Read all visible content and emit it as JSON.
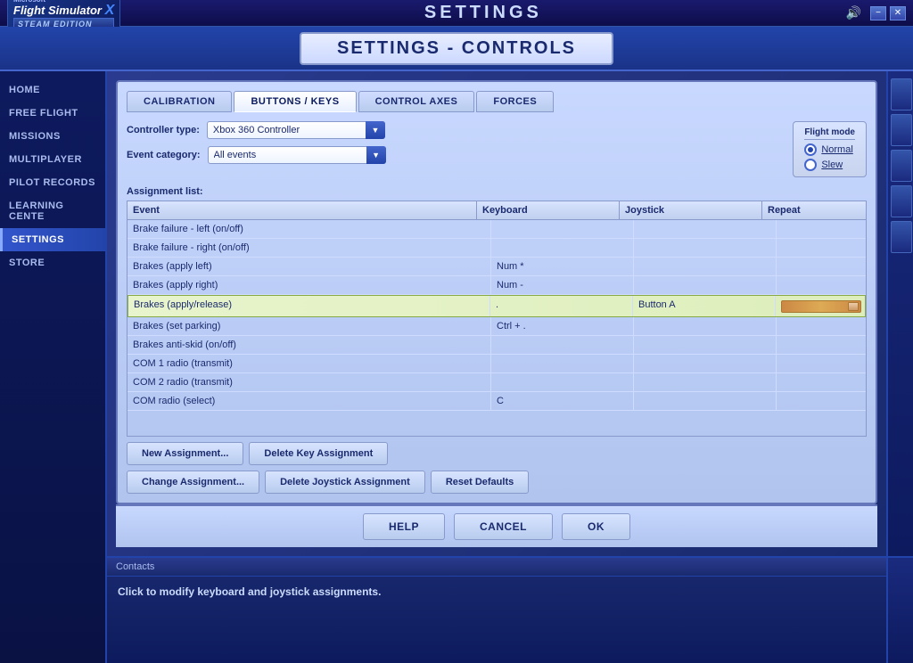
{
  "app": {
    "title": "Microsoft Flight Simulator X",
    "subtitle": "STEAM EDITION",
    "main_title": "SETTINGS",
    "sub_title": "SETTINGS - CONTROLS"
  },
  "titlebar": {
    "sound_icon": "🔊",
    "minimize": "−",
    "close": "✕"
  },
  "sidebar": {
    "items": [
      {
        "id": "home",
        "label": "HOME"
      },
      {
        "id": "free-flight",
        "label": "FREE FLIGHT"
      },
      {
        "id": "missions",
        "label": "MISSIONS"
      },
      {
        "id": "multiplayer",
        "label": "MULTIPLAYER"
      },
      {
        "id": "pilot-records",
        "label": "PILOT RECORDS"
      },
      {
        "id": "learning",
        "label": "LEARNING CENTE"
      },
      {
        "id": "settings",
        "label": "SETTINGS",
        "active": true
      },
      {
        "id": "store",
        "label": "STORE"
      }
    ]
  },
  "tabs": {
    "items": [
      {
        "id": "calibration",
        "label": "CALIBRATION"
      },
      {
        "id": "buttons-keys",
        "label": "BUTTONS / KEYS",
        "active": true
      },
      {
        "id": "control-axes",
        "label": "CONTROL AXES"
      },
      {
        "id": "forces",
        "label": "FORCES"
      }
    ]
  },
  "form": {
    "controller_type_label": "Controller type:",
    "controller_type_value": "Xbox 360 Controller",
    "event_category_label": "Event category:",
    "event_category_value": "All events",
    "assignment_list_label": "Assignment list:"
  },
  "flight_mode": {
    "title": "Flight mode",
    "normal_label": "Normal",
    "slew_label": "Slew",
    "selected": "normal"
  },
  "table": {
    "headers": [
      "Event",
      "Keyboard",
      "Joystick",
      "Repeat"
    ],
    "rows": [
      {
        "event": "Brake failure - left (on/off)",
        "keyboard": "",
        "joystick": "",
        "repeat": "",
        "selected": false
      },
      {
        "event": "Brake failure - right (on/off)",
        "keyboard": "",
        "joystick": "",
        "repeat": "",
        "selected": false
      },
      {
        "event": "Brakes (apply left)",
        "keyboard": "Num *",
        "joystick": "",
        "repeat": "",
        "selected": false
      },
      {
        "event": "Brakes (apply right)",
        "keyboard": "Num -",
        "joystick": "",
        "repeat": "",
        "selected": false
      },
      {
        "event": "Brakes (apply/release)",
        "keyboard": ".",
        "joystick": "Button A",
        "repeat": "slider",
        "selected": true
      },
      {
        "event": "Brakes (set parking)",
        "keyboard": "Ctrl + .",
        "joystick": "",
        "repeat": "",
        "selected": false
      },
      {
        "event": "Brakes anti-skid (on/off)",
        "keyboard": "",
        "joystick": "",
        "repeat": "",
        "selected": false
      },
      {
        "event": "COM 1 radio (transmit)",
        "keyboard": "",
        "joystick": "",
        "repeat": "",
        "selected": false
      },
      {
        "event": "COM 2 radio (transmit)",
        "keyboard": "",
        "joystick": "",
        "repeat": "",
        "selected": false
      },
      {
        "event": "COM radio (select)",
        "keyboard": "C",
        "joystick": "",
        "repeat": "",
        "selected": false
      }
    ]
  },
  "buttons": {
    "new_assignment": "New Assignment...",
    "delete_key": "Delete Key Assignment",
    "change_assignment": "Change Assignment...",
    "delete_joystick": "Delete Joystick Assignment",
    "reset_defaults": "Reset Defaults",
    "help": "HELP",
    "cancel": "CANCEL",
    "ok": "OK"
  },
  "bottom": {
    "contacts_label": "Contacts",
    "status_text": "Click to modify keyboard and joystick assignments."
  }
}
